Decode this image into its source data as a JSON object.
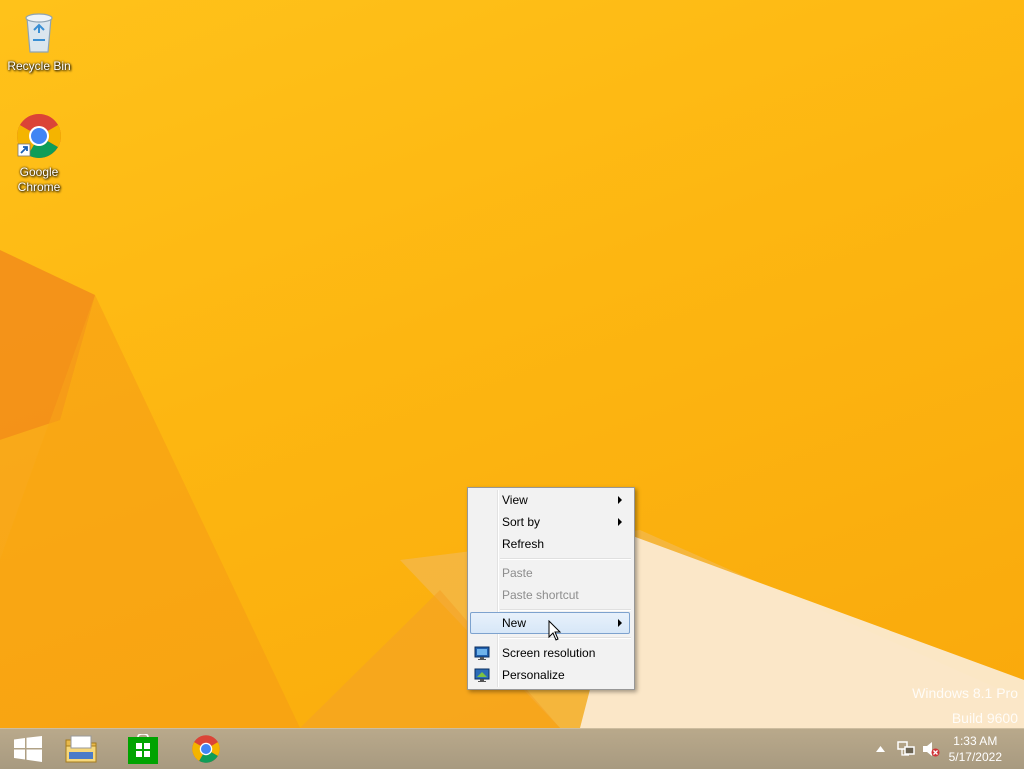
{
  "desktop": {
    "icons": [
      {
        "name": "recycle-bin",
        "label": "Recycle Bin",
        "icon": "recycle-bin-icon"
      },
      {
        "name": "google-chrome",
        "label": "Google\nChrome",
        "icon": "chrome-icon"
      }
    ],
    "watermark": {
      "line1": "Windows 8.1 Pro",
      "line2": "Build 9600"
    }
  },
  "context_menu": {
    "items": [
      {
        "label": "View",
        "submenu": true,
        "enabled": true
      },
      {
        "label": "Sort by",
        "submenu": true,
        "enabled": true
      },
      {
        "label": "Refresh",
        "submenu": false,
        "enabled": true
      },
      {
        "label": "Paste",
        "submenu": false,
        "enabled": false
      },
      {
        "label": "Paste shortcut",
        "submenu": false,
        "enabled": false
      },
      {
        "label": "New",
        "submenu": true,
        "enabled": true,
        "highlighted": true
      },
      {
        "label": "Screen resolution",
        "submenu": false,
        "enabled": true,
        "icon": "display-settings-icon"
      },
      {
        "label": "Personalize",
        "submenu": false,
        "enabled": true,
        "icon": "personalize-icon"
      }
    ]
  },
  "taskbar": {
    "pinned": [
      {
        "name": "start-button",
        "icon": "windows-logo-icon"
      },
      {
        "name": "file-explorer",
        "icon": "folder-icon"
      },
      {
        "name": "store",
        "icon": "store-icon"
      },
      {
        "name": "chrome",
        "icon": "chrome-icon"
      }
    ],
    "tray": {
      "icons": [
        "show-hidden-icons-chevron",
        "network-icon",
        "volume-muted-icon"
      ],
      "time": "1:33 AM",
      "date": "5/17/2022"
    }
  },
  "colors": {
    "wallpaper": "#fdb611",
    "taskbar": "#b09f84",
    "menu_highlight": "#d7e7f8",
    "menu_disabled_text": "#8d8d8d"
  }
}
